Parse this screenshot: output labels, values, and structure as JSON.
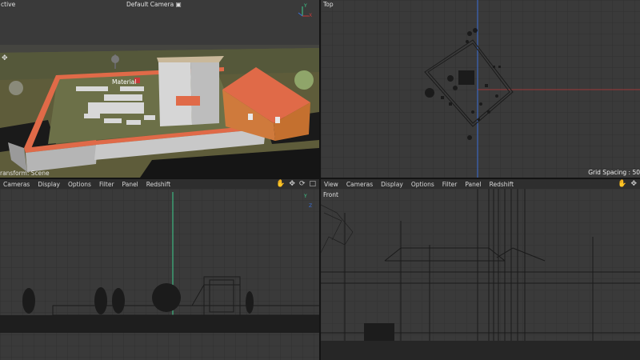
{
  "perspective": {
    "view_name": "ctive",
    "camera_label": "Default Camera",
    "camera_icon": "camera-icon",
    "material_tag": "Material",
    "status_text": "ransform: Scene",
    "axis_y": "Y",
    "axis_x": "X"
  },
  "top": {
    "view_name": "Top",
    "grid_spacing": "Grid Spacing : 50"
  },
  "right": {
    "menu": [
      "Cameras",
      "Display",
      "Options",
      "Filter",
      "Panel",
      "Redshift"
    ],
    "axis_y": "Y",
    "axis_z": "Z"
  },
  "front": {
    "menu": [
      "View",
      "Cameras",
      "Display",
      "Options",
      "Filter",
      "Panel",
      "Redshift"
    ],
    "view_name": "Front"
  },
  "nav_icons": [
    "hand-icon",
    "move-icon",
    "rotate-icon",
    "maximize-icon"
  ],
  "colors": {
    "axis_green": "#3ecf8e",
    "axis_blue": "#3a6fd8",
    "axis_red": "#c83a3a",
    "roof": "#e06a48",
    "wall": "#cf7a3c"
  }
}
